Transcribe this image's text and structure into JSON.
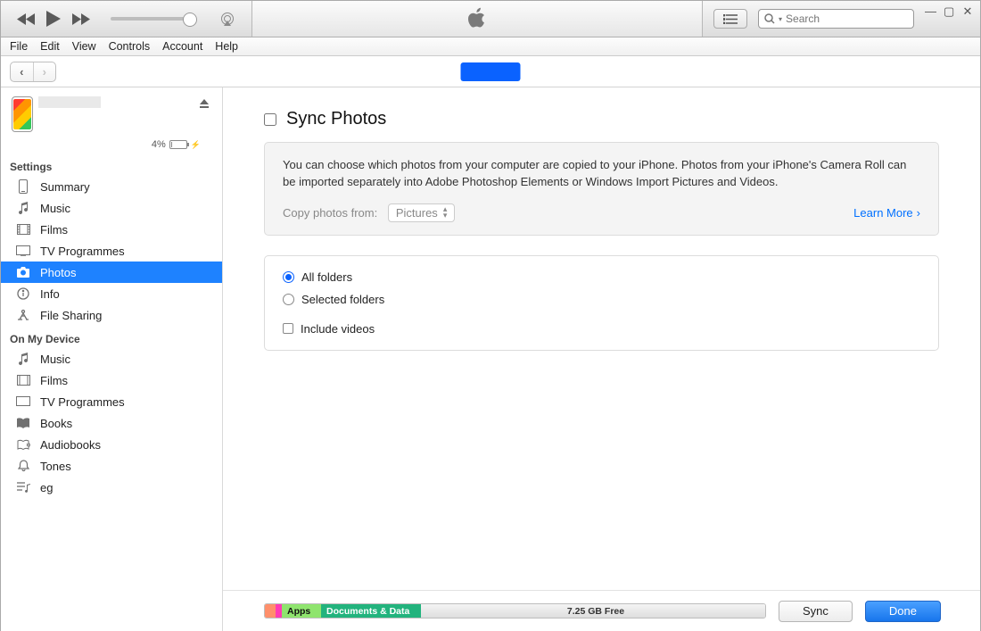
{
  "search": {
    "placeholder": "Search"
  },
  "menubar": [
    "File",
    "Edit",
    "View",
    "Controls",
    "Account",
    "Help"
  ],
  "device": {
    "battery_pct": "4%"
  },
  "sidebar": {
    "settings_label": "Settings",
    "settings": [
      {
        "label": "Summary"
      },
      {
        "label": "Music"
      },
      {
        "label": "Films"
      },
      {
        "label": "TV Programmes"
      },
      {
        "label": "Photos"
      },
      {
        "label": "Info"
      },
      {
        "label": "File Sharing"
      }
    ],
    "ondevice_label": "On My Device",
    "ondevice": [
      {
        "label": "Music"
      },
      {
        "label": "Films"
      },
      {
        "label": "TV Programmes"
      },
      {
        "label": "Books"
      },
      {
        "label": "Audiobooks"
      },
      {
        "label": "Tones"
      },
      {
        "label": "eg"
      }
    ]
  },
  "main": {
    "title": "Sync Photos",
    "info_text": "You can choose which photos from your computer are copied to your iPhone. Photos from your iPhone's Camera Roll can be imported separately into Adobe Photoshop Elements or Windows Import Pictures and Videos.",
    "source_label": "Copy photos from:",
    "source_value": "Pictures",
    "learn_more": "Learn More",
    "opt_all": "All folders",
    "opt_selected": "Selected folders",
    "opt_videos": "Include videos"
  },
  "footer": {
    "apps_label": "Apps",
    "docs_label": "Documents & Data",
    "free_label": "7.25 GB Free",
    "sync_label": "Sync",
    "done_label": "Done"
  }
}
